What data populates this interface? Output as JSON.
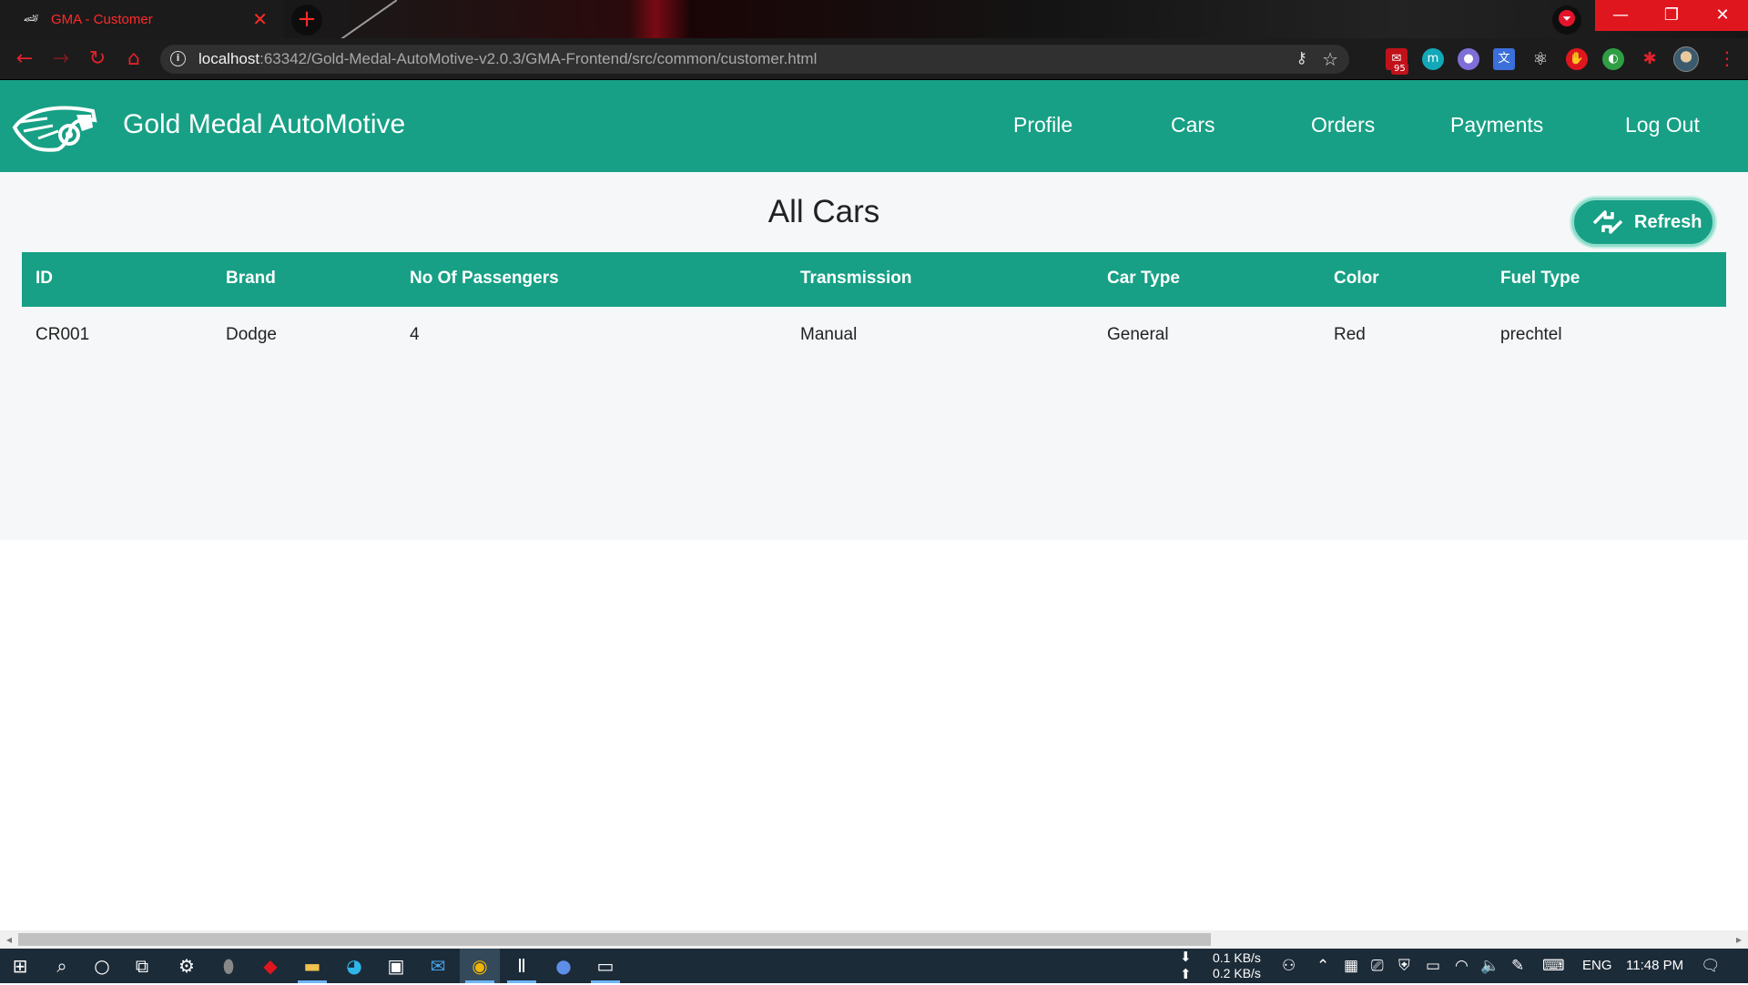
{
  "browser": {
    "tab_title": "GMA - Customer",
    "tab_close": "✕",
    "new_tab": "+",
    "url_host": "localhost",
    "url_path": ":63342/Gold-Medal-AutoMotive-v2.0.3/GMA-Frontend/src/common/customer.html",
    "extension_badge": "95",
    "window_buttons": {
      "minimize": "—",
      "restore": "❐",
      "close": "✕"
    }
  },
  "app": {
    "brand_name": "Gold Medal AutoMotive",
    "nav": [
      "Profile",
      "Cars",
      "Orders",
      "Payments",
      "Log Out"
    ]
  },
  "page": {
    "title": "All Cars",
    "refresh_label": "Refresh"
  },
  "table": {
    "headers": [
      "ID",
      "Brand",
      "No Of Passengers",
      "Transmission",
      "Car Type",
      "Color",
      "Fuel Type"
    ],
    "rows": [
      [
        "CR001",
        "Dodge",
        "4",
        "Manual",
        "General",
        "Red",
        "prechtel"
      ]
    ]
  },
  "taskbar": {
    "net_down": "0.1 KB/s",
    "net_up": "0.2 KB/s",
    "language": "ENG",
    "time": "11:48 PM"
  },
  "colors": {
    "accent": "#17a085",
    "browser_accent": "#e2222c",
    "content_bg": "#f5f7f9"
  }
}
